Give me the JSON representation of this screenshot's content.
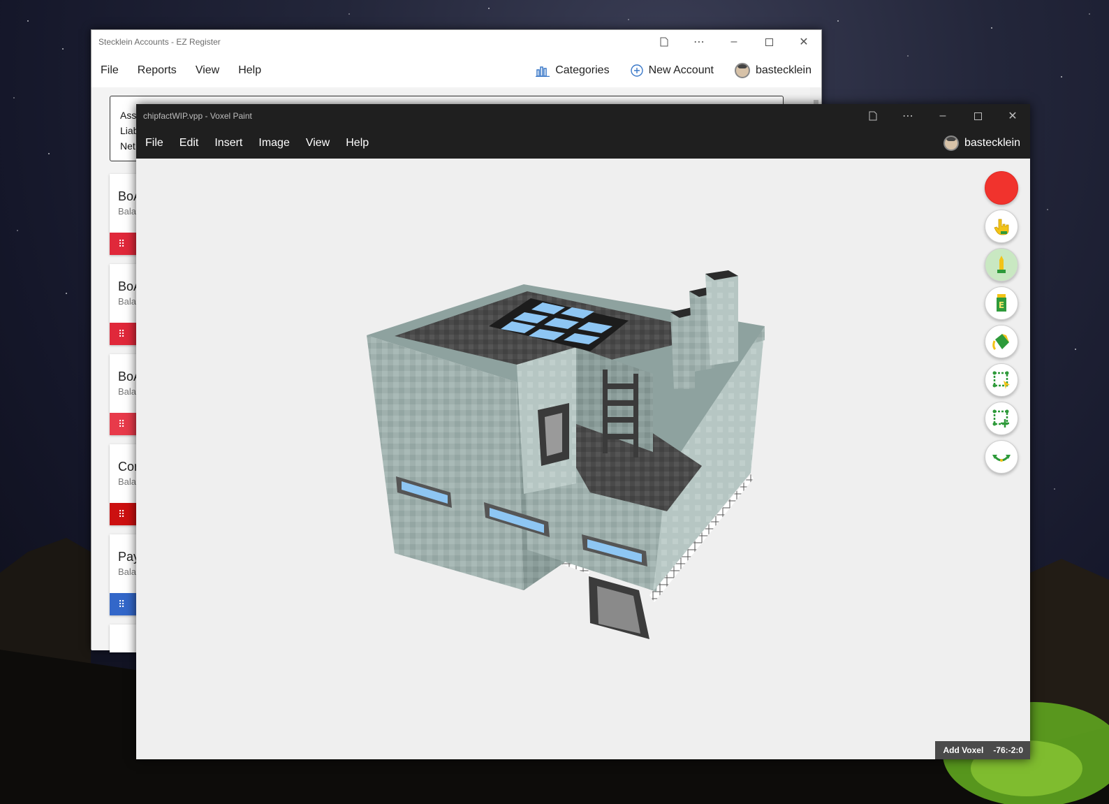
{
  "ez_register": {
    "title": "Stecklein Accounts - EZ Register",
    "menu": [
      "File",
      "Reports",
      "View",
      "Help"
    ],
    "categories_label": "Categories",
    "new_account_label": "New Account",
    "username": "bastecklein",
    "summary": [
      "Asse",
      "Liab",
      "Net"
    ],
    "accounts": [
      {
        "name": "BoA",
        "balance": "Bala",
        "color": "#e0283a"
      },
      {
        "name": "BoA",
        "balance": "Bala",
        "color": "#e0283a"
      },
      {
        "name": "BoA",
        "balance": "Bala",
        "color": "#e83a4a"
      },
      {
        "name": "Cor",
        "balance": "Bala",
        "color": "#cc1010"
      },
      {
        "name": "Pay",
        "balance": "Bala",
        "color": "#3367c9"
      }
    ],
    "drag_icon": "⠿"
  },
  "voxel_paint": {
    "title": "chipfactWIP.vpp - Voxel Paint",
    "menu": [
      "File",
      "Edit",
      "Insert",
      "Image",
      "View",
      "Help"
    ],
    "username": "bastecklein",
    "current_color": "#f1332d",
    "tools": [
      "color-picker",
      "pointer-hand-icon",
      "pencil-tool-icon",
      "eraser-tool-icon",
      "paint-bucket-icon",
      "box-select-icon",
      "move-select-icon",
      "rotate-icon"
    ],
    "status": {
      "mode": "Add Voxel",
      "coords": "-76:-2:0"
    }
  }
}
